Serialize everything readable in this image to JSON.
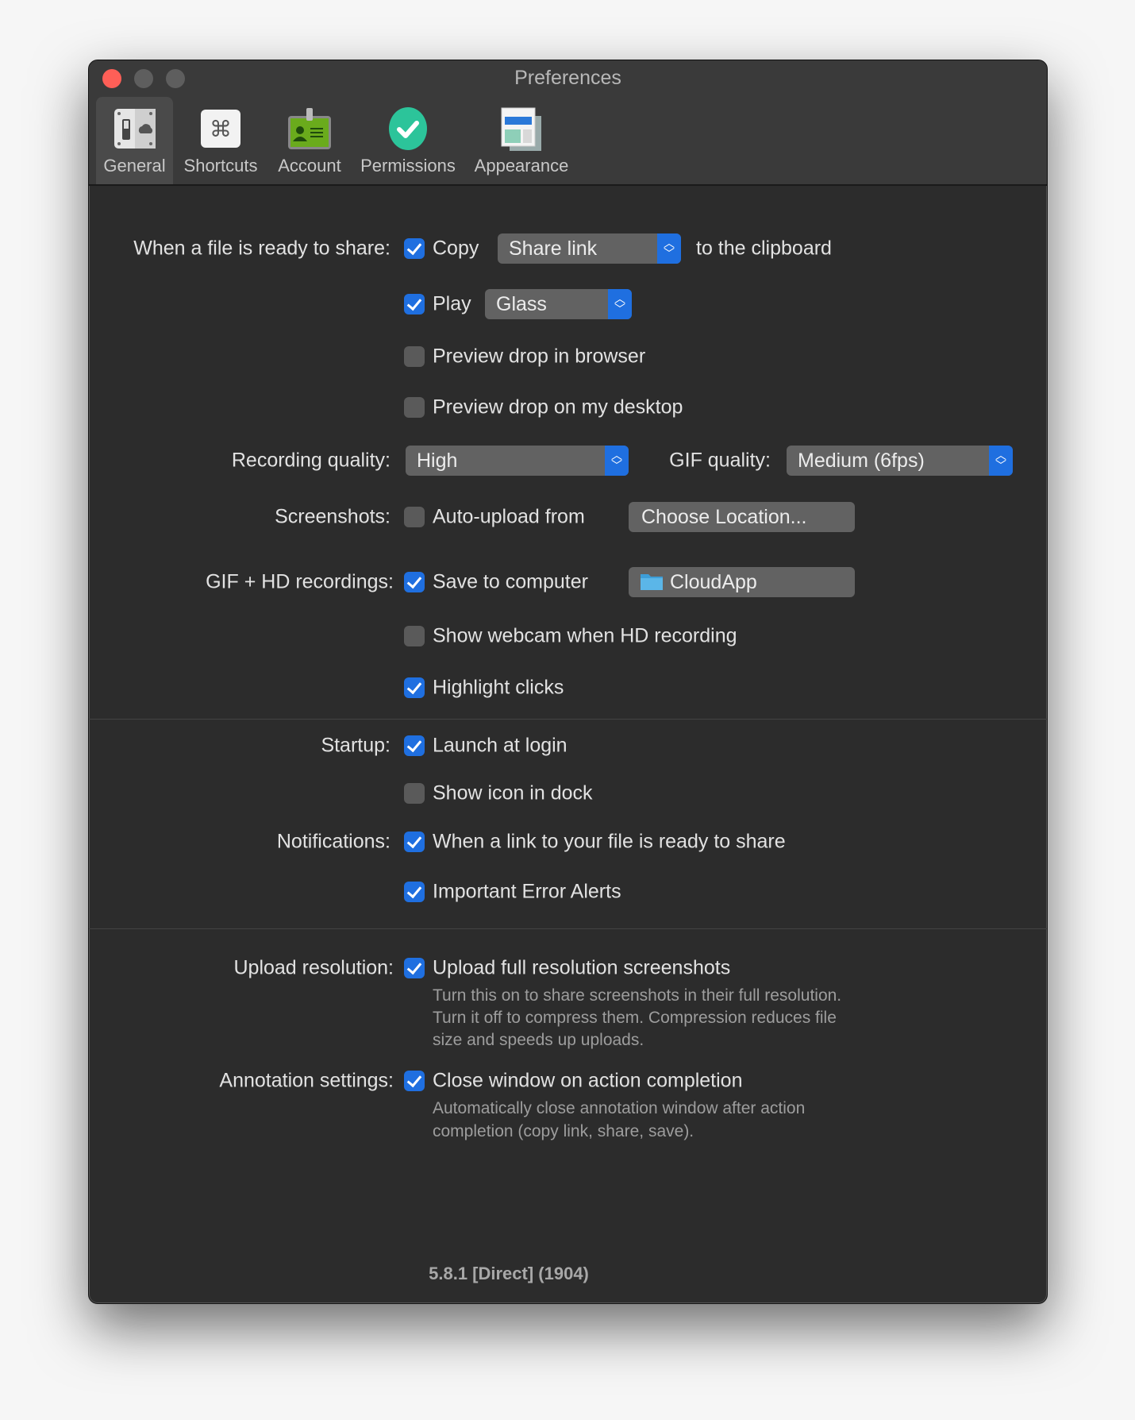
{
  "window": {
    "title": "Preferences"
  },
  "colors": {
    "accent": "#1f6fe0",
    "close": "#fe5f57",
    "background": "#2c2c2c"
  },
  "tabs": [
    {
      "label": "General",
      "icon": "general-switch-icon",
      "selected": true
    },
    {
      "label": "Shortcuts",
      "icon": "command-key-icon"
    },
    {
      "label": "Account",
      "icon": "id-badge-icon"
    },
    {
      "label": "Permissions",
      "icon": "checkmark-circle-icon"
    },
    {
      "label": "Appearance",
      "icon": "window-layout-icon"
    }
  ],
  "share": {
    "label": "When a file is ready to share:",
    "copy": {
      "label": "Copy",
      "checked": true
    },
    "copy_select": "Share link",
    "clipboard_text": "to the clipboard",
    "play": {
      "label": "Play",
      "checked": true
    },
    "play_select": "Glass",
    "preview_browser": {
      "label": "Preview drop in browser",
      "checked": false
    },
    "preview_desktop": {
      "label": "Preview drop on my desktop",
      "checked": false
    }
  },
  "recording": {
    "label": "Recording quality:",
    "value": "High",
    "gif_label": "GIF quality:",
    "gif_value": "Medium (6fps)"
  },
  "screenshots": {
    "label": "Screenshots:",
    "auto_upload": {
      "label": "Auto-upload from",
      "checked": false
    },
    "choose_button": "Choose Location..."
  },
  "gifhd": {
    "label": "GIF + HD recordings:",
    "save": {
      "label": "Save to computer",
      "checked": true
    },
    "folder": "CloudApp",
    "webcam": {
      "label": "Show webcam when HD recording",
      "checked": false
    },
    "highlight": {
      "label": "Highlight clicks",
      "checked": true
    }
  },
  "startup": {
    "label": "Startup:",
    "launch": {
      "label": "Launch at login",
      "checked": true
    },
    "dock": {
      "label": "Show icon in dock",
      "checked": false
    }
  },
  "notifications": {
    "label": "Notifications:",
    "link_ready": {
      "label": "When a link to your file is ready to share",
      "checked": true
    },
    "errors": {
      "label": "Important Error Alerts",
      "checked": true
    }
  },
  "upload": {
    "label": "Upload resolution:",
    "full": {
      "label": "Upload full resolution screenshots",
      "checked": true
    },
    "desc": [
      "Turn this on to share screenshots in their full resolution.",
      "Turn it off to compress them. Compression reduces file",
      "size and speeds up uploads."
    ]
  },
  "annotation": {
    "label": "Annotation settings:",
    "close": {
      "label": "Close window on action completion",
      "checked": true
    },
    "desc": [
      "Automatically close annotation window after action",
      "completion (copy link, share, save)."
    ]
  },
  "version": "5.8.1 [Direct] (1904)"
}
